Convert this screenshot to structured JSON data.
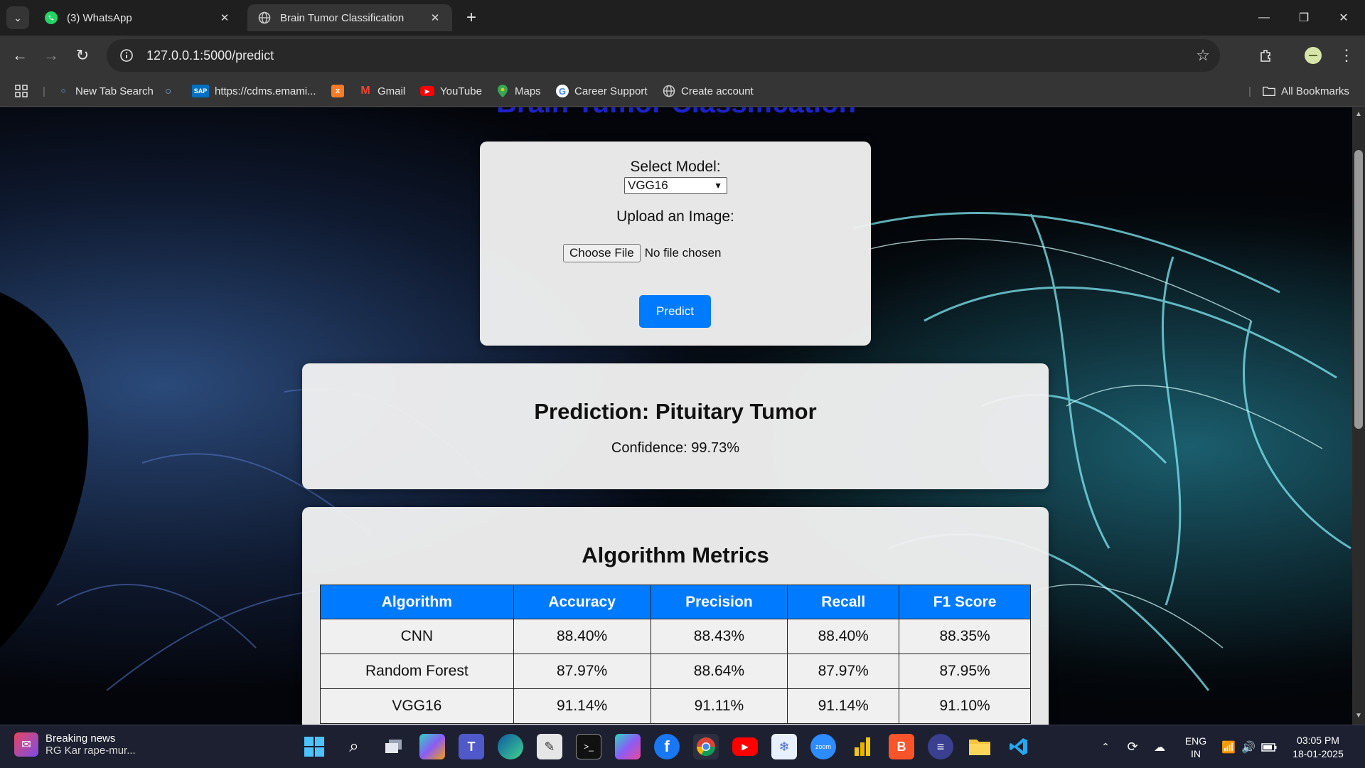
{
  "browser": {
    "tabs": [
      {
        "title": "(3) WhatsApp",
        "icon": "whatsapp-icon"
      },
      {
        "title": "Brain Tumor Classification",
        "icon": "globe-icon"
      }
    ],
    "url": "127.0.0.1:5000/predict",
    "bookmarks": [
      {
        "label": "New Tab Search",
        "icon": "search-icon"
      },
      {
        "label": "https://cdms.emami...",
        "icon": "sap-icon"
      },
      {
        "label": "",
        "icon": "xampp-icon"
      },
      {
        "label": "Gmail",
        "icon": "gmail-icon"
      },
      {
        "label": "YouTube",
        "icon": "youtube-icon"
      },
      {
        "label": "Maps",
        "icon": "maps-icon"
      },
      {
        "label": "Career Support",
        "icon": "google-icon"
      },
      {
        "label": "Create account",
        "icon": "globe-icon"
      }
    ],
    "all_bookmarks": "All Bookmarks"
  },
  "page": {
    "heading": "Brain Tumor Classification",
    "form": {
      "select_label": "Select Model:",
      "selected_model": "VGG16",
      "upload_label": "Upload an Image:",
      "choose_file": "Choose File",
      "no_file": "No file chosen",
      "predict": "Predict"
    },
    "prediction": {
      "title": "Prediction: Pituitary Tumor",
      "confidence": "Confidence: 99.73%"
    },
    "metrics": {
      "title": "Algorithm Metrics",
      "headers": [
        "Algorithm",
        "Accuracy",
        "Precision",
        "Recall",
        "F1 Score"
      ],
      "rows": [
        [
          "CNN",
          "88.40%",
          "88.43%",
          "88.40%",
          "88.35%"
        ],
        [
          "Random Forest",
          "87.97%",
          "88.64%",
          "87.97%",
          "87.95%"
        ],
        [
          "VGG16",
          "91.14%",
          "91.11%",
          "91.14%",
          "91.10%"
        ]
      ]
    }
  },
  "taskbar": {
    "news_title": "Breaking news",
    "news_sub": "RG Kar rape-mur...",
    "lang1": "ENG",
    "lang2": "IN",
    "time": "03:05 PM",
    "date": "18-01-2025"
  },
  "colors": {
    "accent": "#007bff",
    "heading": "#1e22c8"
  }
}
